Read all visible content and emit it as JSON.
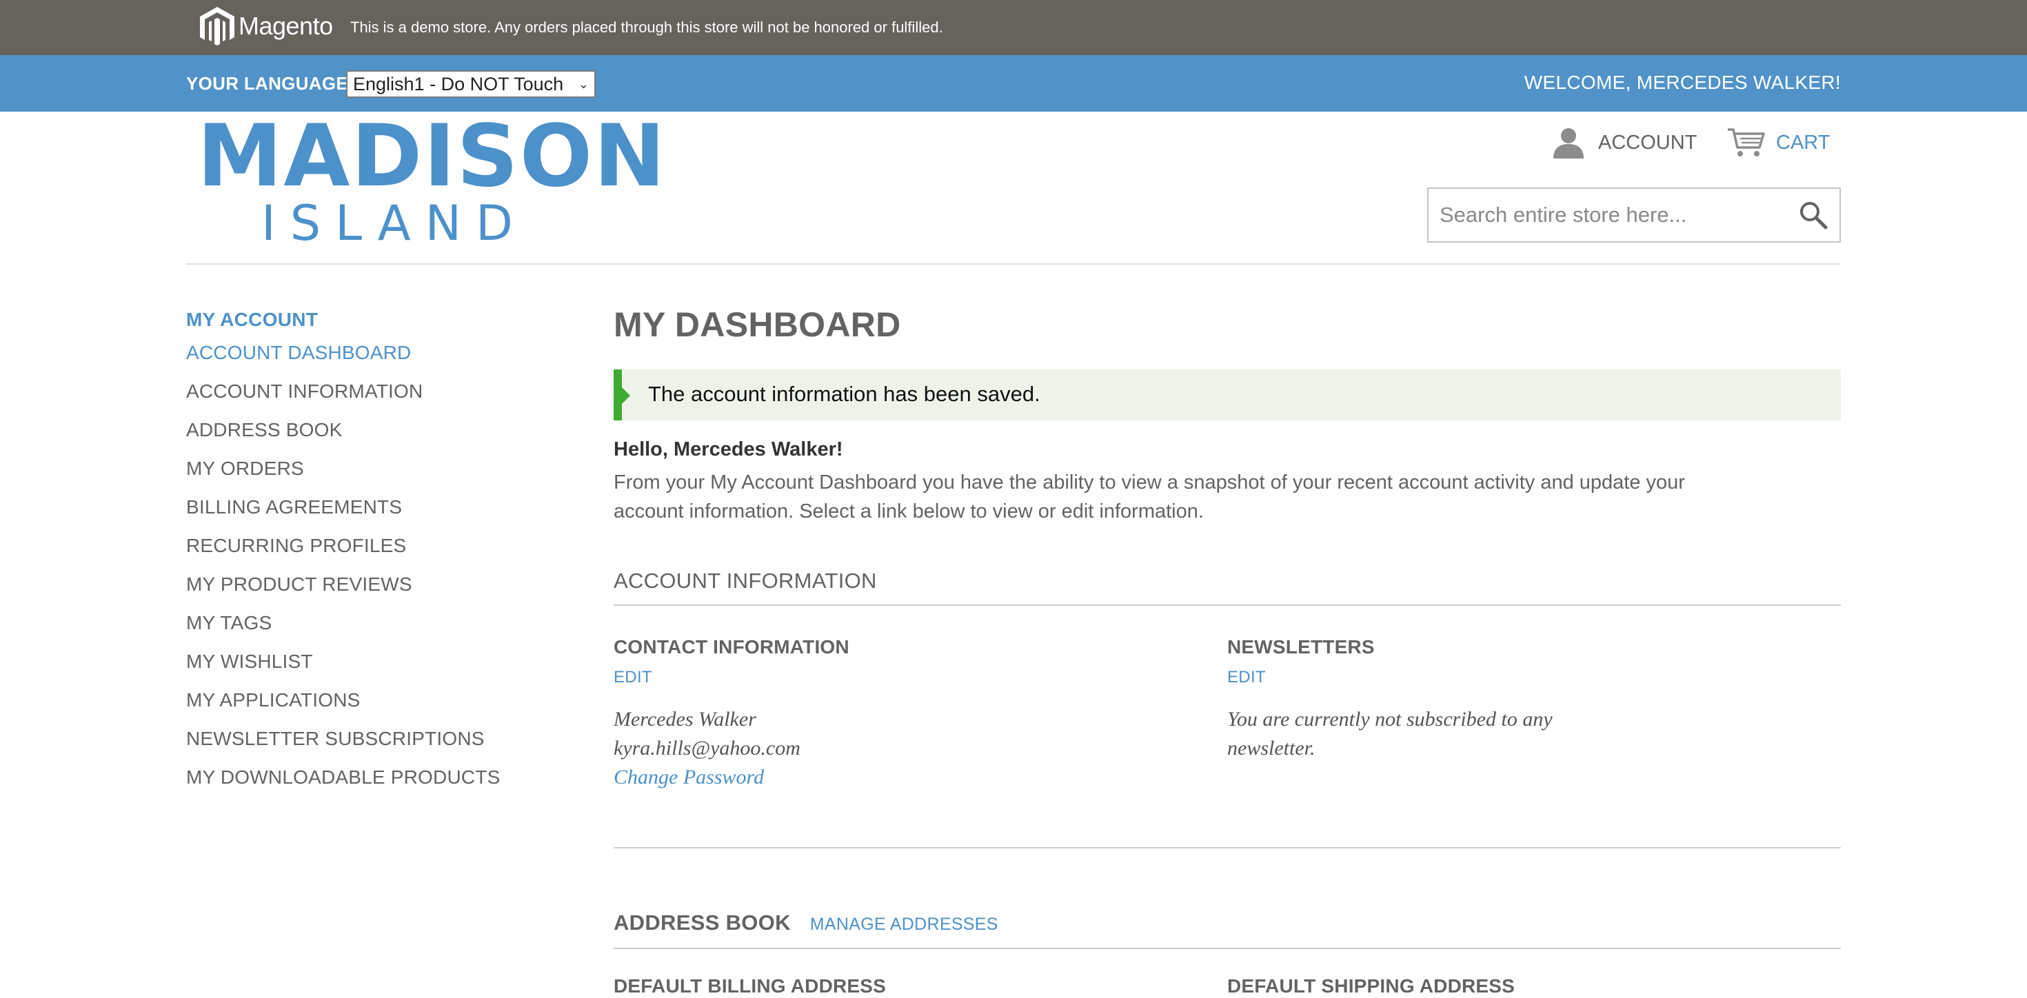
{
  "demo_bar": {
    "logo_text": "Magento",
    "notice": "This is a demo store. Any orders placed through this store will not be honored or fulfilled."
  },
  "lang_bar": {
    "label": "YOUR LANGUAGE:",
    "selected_language": "English1 - Do NOT Touch",
    "welcome": "WELCOME, MERCEDES WALKER!"
  },
  "header": {
    "brand_main": "MADISON",
    "brand_sub": "ISLAND",
    "account_label": "ACCOUNT",
    "cart_label": "CART",
    "search_placeholder": "Search entire store here..."
  },
  "sidebar": {
    "title": "MY ACCOUNT",
    "items": [
      {
        "label": "ACCOUNT DASHBOARD"
      },
      {
        "label": "ACCOUNT INFORMATION"
      },
      {
        "label": "ADDRESS BOOK"
      },
      {
        "label": "MY ORDERS"
      },
      {
        "label": "BILLING AGREEMENTS"
      },
      {
        "label": "RECURRING PROFILES"
      },
      {
        "label": "MY PRODUCT REVIEWS"
      },
      {
        "label": "MY TAGS"
      },
      {
        "label": "MY WISHLIST"
      },
      {
        "label": "MY APPLICATIONS"
      },
      {
        "label": "NEWSLETTER SUBSCRIPTIONS"
      },
      {
        "label": "MY DOWNLOADABLE PRODUCTS"
      }
    ]
  },
  "main": {
    "title": "MY DASHBOARD",
    "success_message": "The account information has been saved.",
    "hello": "Hello, Mercedes Walker!",
    "intro": "From your My Account Dashboard you have the ability to view a snapshot of your recent account activity and update your account information. Select a link below to view or edit information.",
    "account_info": {
      "heading": "ACCOUNT INFORMATION",
      "contact": {
        "title": "CONTACT INFORMATION",
        "edit_label": "EDIT",
        "name": "Mercedes Walker",
        "email": "kyra.hills@yahoo.com",
        "change_password": "Change Password"
      },
      "newsletters": {
        "title": "NEWSLETTERS",
        "edit_label": "EDIT",
        "status": "You are currently not subscribed to any newsletter."
      }
    },
    "address_book": {
      "heading": "ADDRESS BOOK",
      "manage_label": "MANAGE ADDRESSES",
      "billing_title": "DEFAULT BILLING ADDRESS",
      "shipping_title": "DEFAULT SHIPPING ADDRESS"
    }
  },
  "colors": {
    "demo_bar": "#66625c",
    "lang_bar": "#5192c8",
    "accent": "#4d91cb",
    "success_border": "#3faa32",
    "success_bg": "#eef3ea"
  },
  "icons": {
    "logo": "magento-logo-icon",
    "account": "user-icon",
    "cart": "cart-icon",
    "search": "search-icon"
  }
}
